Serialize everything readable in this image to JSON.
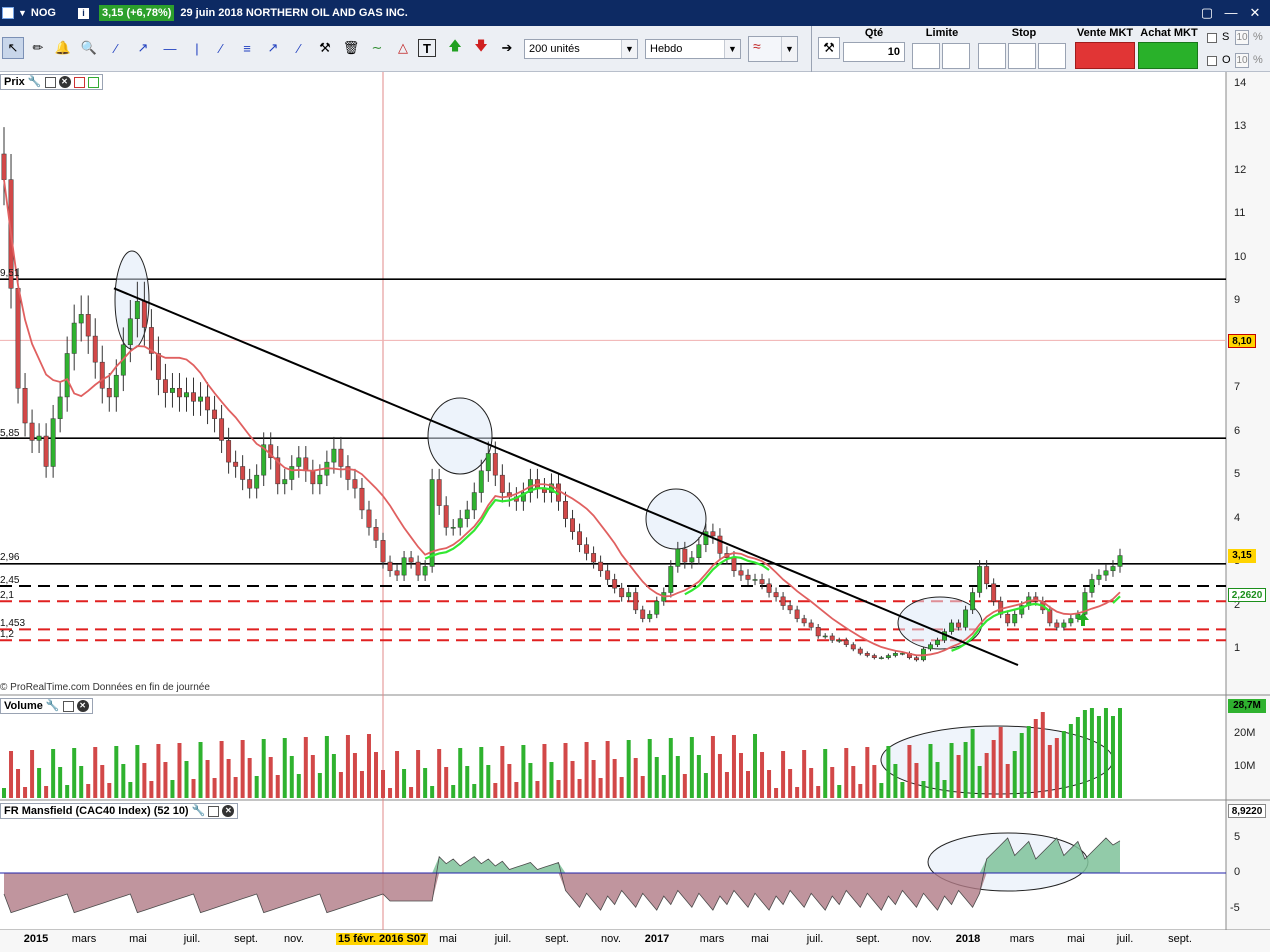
{
  "window": {
    "symbol": "NOG",
    "price_change": "3,15 (+6,78%)",
    "title": "29 juin 2018 NORTHERN OIL AND GAS INC.",
    "controls": [
      "▢",
      "—",
      "✕"
    ]
  },
  "toolbar": {
    "quantity_select": "200 unités",
    "period_select": "Hebdo",
    "qty_label": "Qté",
    "qty_value": "10",
    "limit_label": "Limite",
    "stop_label": "Stop",
    "sell_label": "Vente MKT",
    "buy_label": "Achat MKT",
    "s_label": "S",
    "o_label": "O",
    "pct_s": "10",
    "pct_o": "10",
    "pct_sign": "%"
  },
  "price_panel": {
    "label": "Prix",
    "footer": "© ProRealTime.com  Données en fin de journée",
    "y_ticks": [
      "14",
      "13",
      "12",
      "11",
      "10",
      "9",
      "8",
      "7",
      "6",
      "5",
      "4",
      "3",
      "2",
      "1"
    ],
    "levels": [
      "9,51",
      "5,85",
      "2,96",
      "2,45",
      "2,1",
      "1,453",
      "1,2"
    ],
    "tag_red": "8,10",
    "tag_last": "3,15",
    "tag_ma": "2,2620"
  },
  "volume_panel": {
    "label": "Volume",
    "y_ticks": [
      "20M",
      "10M"
    ],
    "tag": "28,7M"
  },
  "mansfield_panel": {
    "label": "FR Mansfield (CAC40 Index) (52 10)",
    "y_ticks": [
      "5",
      "0",
      "-5"
    ],
    "tag": "8,9220"
  },
  "x_axis": {
    "labels": [
      "2015",
      "mars",
      "mai",
      "juil.",
      "sept.",
      "nov.",
      "2016",
      "mai",
      "juil.",
      "sept.",
      "nov.",
      "2017",
      "mars",
      "mai",
      "juil.",
      "sept.",
      "nov.",
      "2018",
      "mars",
      "mai",
      "juil.",
      "sept."
    ],
    "cursor_label": "15 févr. 2016 S07"
  },
  "colors": {
    "up": "#2fb22f",
    "down": "#d24848",
    "ma": "#e06060",
    "ma_green": "#32e832",
    "title_bg": "#0d2a63"
  },
  "chart_data": {
    "type": "candlestick",
    "title": "",
    "xlabel": "",
    "ylabel": "",
    "ylim": [
      0,
      14.5
    ],
    "x_range": [
      "2014-12",
      "2018-10"
    ],
    "weekly_close": [
      11.8,
      9.3,
      7.0,
      6.2,
      5.8,
      5.9,
      5.2,
      6.3,
      6.8,
      7.8,
      8.5,
      8.7,
      8.2,
      7.6,
      7.0,
      6.8,
      7.3,
      8.0,
      8.6,
      9.0,
      8.4,
      7.8,
      7.2,
      6.9,
      7.0,
      6.8,
      6.9,
      6.7,
      6.8,
      6.5,
      6.3,
      5.8,
      5.3,
      5.2,
      4.9,
      4.7,
      5.0,
      5.7,
      5.4,
      4.8,
      4.9,
      5.2,
      5.4,
      5.1,
      4.8,
      5.0,
      5.3,
      5.6,
      5.2,
      4.9,
      4.7,
      4.2,
      3.8,
      3.5,
      3.0,
      2.8,
      2.7,
      3.1,
      3.0,
      2.7,
      2.9,
      4.9,
      4.3,
      3.8,
      3.8,
      4.0,
      4.2,
      4.6,
      5.1,
      5.5,
      5.0,
      4.6,
      4.5,
      4.4,
      4.6,
      4.9,
      4.7,
      4.6,
      4.8,
      4.4,
      4.0,
      3.7,
      3.4,
      3.2,
      3.0,
      2.8,
      2.6,
      2.4,
      2.2,
      2.3,
      1.9,
      1.7,
      1.8,
      2.1,
      2.3,
      2.9,
      3.3,
      3.0,
      3.1,
      3.4,
      3.7,
      3.6,
      3.2,
      3.1,
      2.8,
      2.7,
      2.6,
      2.6,
      2.5,
      2.3,
      2.2,
      2.0,
      1.9,
      1.7,
      1.6,
      1.5,
      1.3,
      1.3,
      1.2,
      1.2,
      1.1,
      1.0,
      0.9,
      0.85,
      0.8,
      0.8,
      0.85,
      0.9,
      0.9,
      0.8,
      0.75,
      1.0,
      1.1,
      1.2,
      1.4,
      1.6,
      1.5,
      1.9,
      2.3,
      2.9,
      2.5,
      2.1,
      1.8,
      1.6,
      1.8,
      2.0,
      2.2,
      2.1,
      1.9,
      1.6,
      1.5,
      1.6,
      1.7,
      1.8,
      2.3,
      2.6,
      2.7,
      2.8,
      2.9,
      3.15
    ],
    "moving_average_label": "",
    "levels": [
      9.51,
      5.85,
      2.96,
      2.45,
      2.1,
      1.453,
      1.2
    ],
    "trendline": {
      "start": [
        "2015-04",
        9.3
      ],
      "end": [
        "2018-03",
        0.8
      ]
    },
    "volume_max": 28.7,
    "mansfield_last": 8.922
  }
}
